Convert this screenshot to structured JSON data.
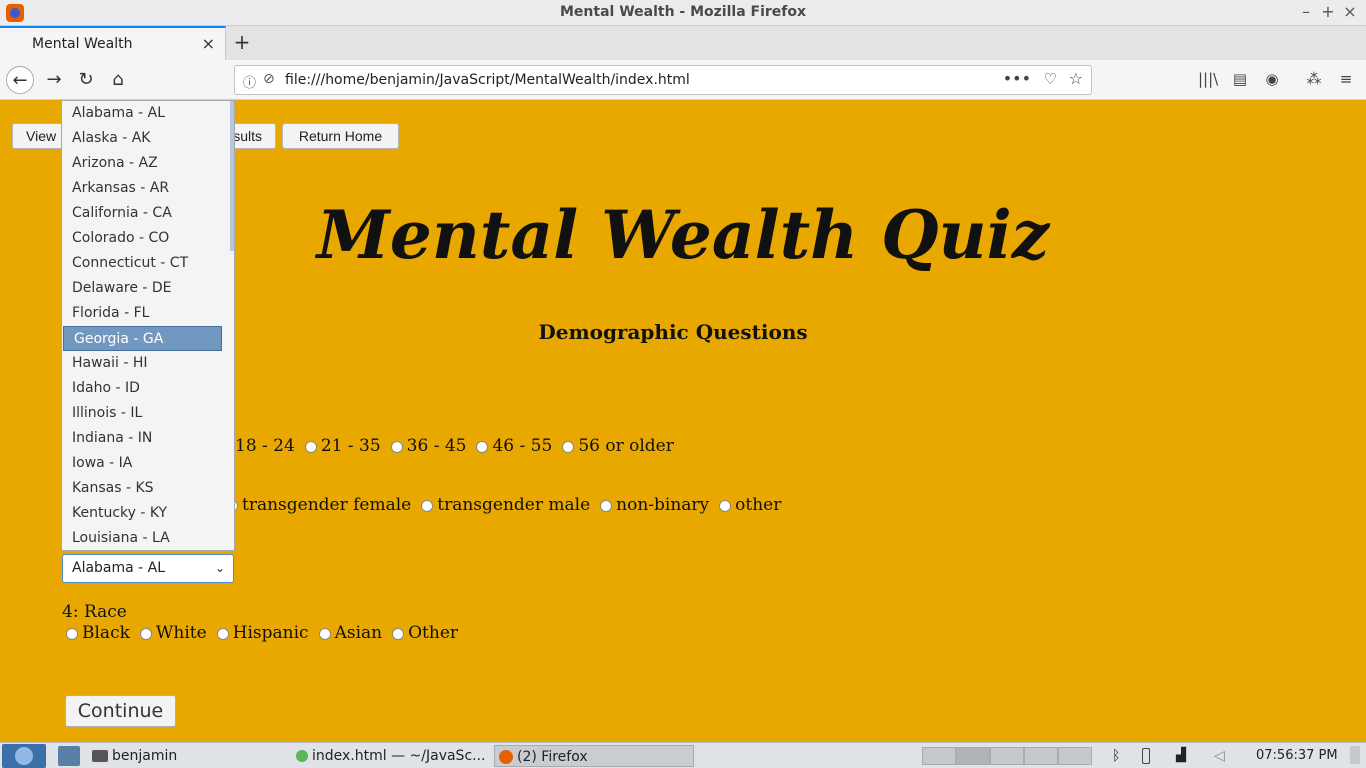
{
  "window": {
    "title": "Mental Wealth - Mozilla Firefox",
    "controls": [
      "–",
      "+",
      "×"
    ]
  },
  "tabs": [
    {
      "label": "Mental Wealth",
      "close": "×"
    }
  ],
  "new_tab": "+",
  "navbar": {
    "back": "←",
    "forward": "→",
    "reload": "↻",
    "home": "⌂",
    "url": "file:///home/benjamin/JavaScript/MentalWealth/index.html",
    "info_icon": "ⓘ",
    "tracking_icon": "⊘",
    "more": "•••",
    "pocket": "♡",
    "star": "☆",
    "library": "|||\\",
    "sidebar": "▤",
    "account": "◉",
    "extensions": "⁂",
    "menu": "≡"
  },
  "page": {
    "buttons": {
      "view": "View",
      "results_fragment": "sults",
      "home": "Return Home"
    },
    "heading": "Mental Wealth Quiz",
    "subheading": "Demographic Questions",
    "age_options": [
      "18 - 24",
      "21 - 35",
      "36 - 45",
      "46 - 55",
      "56 or older"
    ],
    "gender_options": [
      "transgender female",
      "transgender male",
      "non-binary",
      "other"
    ],
    "state_selected": "Alabama - AL",
    "state_chevron": "⌄",
    "q4_label": "4: Race",
    "race_options": [
      "Black",
      "White",
      "Hispanic",
      "Asian",
      "Other"
    ],
    "continue": "Continue"
  },
  "dropdown": {
    "items": [
      "Alabama - AL",
      "Alaska - AK",
      "Arizona - AZ",
      "Arkansas - AR",
      "California - CA",
      "Colorado - CO",
      "Connecticut - CT",
      "Delaware - DE",
      "Florida - FL",
      "Georgia - GA",
      "Hawaii - HI",
      "Idaho - ID",
      "Illinois - IL",
      "Indiana - IN",
      "Iowa - IA",
      "Kansas - KS",
      "Kentucky - KY",
      "Louisiana - LA"
    ],
    "selected_index": 9
  },
  "taskbar": {
    "folder": "benjamin",
    "editor": "index.html — ~/JavaSc...",
    "firefox": "(2) Firefox",
    "time": "07:56:37 PM"
  },
  "colors": {
    "page_bg": "#e8a800",
    "selected_item": "#7398c0"
  }
}
